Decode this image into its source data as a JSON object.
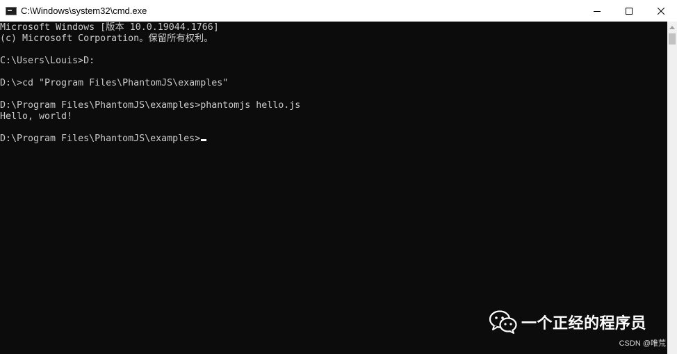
{
  "window": {
    "title": "C:\\Windows\\system32\\cmd.exe"
  },
  "caption_buttons": {
    "minimize": "minimize-icon",
    "maximize": "maximize-icon",
    "close": "close-icon"
  },
  "terminal": {
    "lines": [
      "Microsoft Windows [版本 10.0.19044.1766]",
      "(c) Microsoft Corporation。保留所有权利。",
      "",
      "C:\\Users\\Louis>D:",
      "",
      "D:\\>cd \"Program Files\\PhantomJS\\examples\"",
      "",
      "D:\\Program Files\\PhantomJS\\examples>phantomjs hello.js",
      "Hello, world!",
      "",
      "D:\\Program Files\\PhantomJS\\examples>"
    ]
  },
  "watermark": {
    "icon": "wechat-icon",
    "title": "一个正经的程序员",
    "source": "CSDN @唯荒"
  },
  "colors": {
    "terminal_bg": "#0c0c0c",
    "terminal_text": "#cccccc",
    "titlebar_bg": "#ffffff"
  }
}
